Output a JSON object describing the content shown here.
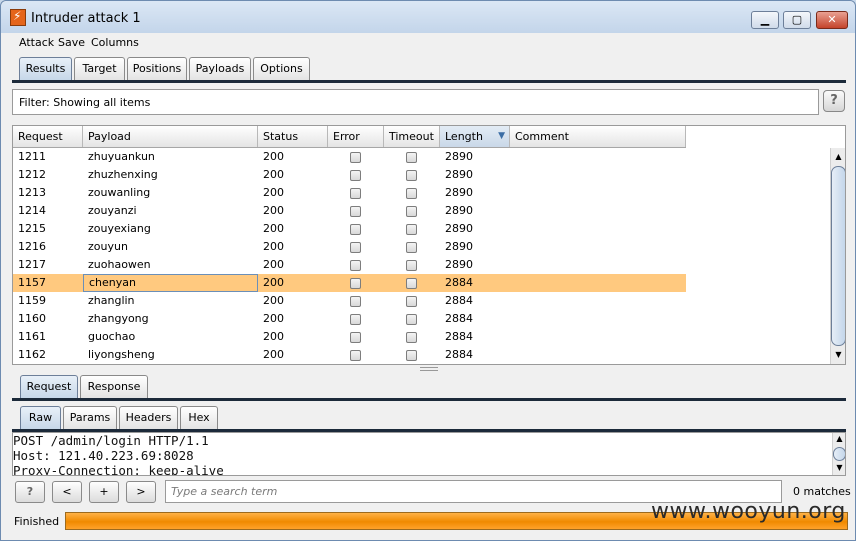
{
  "window": {
    "title": "Intruder attack 1"
  },
  "menu": [
    "Attack",
    "Save",
    "Columns"
  ],
  "main_tabs": [
    "Results",
    "Target",
    "Positions",
    "Payloads",
    "Options"
  ],
  "filter": {
    "text": "Filter:  Showing all items",
    "help": "?"
  },
  "table": {
    "columns": [
      "Request",
      "Payload",
      "Status",
      "Error",
      "Timeout",
      "Length",
      "Comment"
    ],
    "sorted_column": "Length",
    "rows": [
      {
        "request": "1211",
        "payload": "zhuyuankun",
        "status": "200",
        "error": false,
        "timeout": false,
        "length": "2890",
        "comment": ""
      },
      {
        "request": "1212",
        "payload": "zhuzhenxing",
        "status": "200",
        "error": false,
        "timeout": false,
        "length": "2890",
        "comment": ""
      },
      {
        "request": "1213",
        "payload": "zouwanling",
        "status": "200",
        "error": false,
        "timeout": false,
        "length": "2890",
        "comment": ""
      },
      {
        "request": "1214",
        "payload": "zouyanzi",
        "status": "200",
        "error": false,
        "timeout": false,
        "length": "2890",
        "comment": ""
      },
      {
        "request": "1215",
        "payload": "zouyexiang",
        "status": "200",
        "error": false,
        "timeout": false,
        "length": "2890",
        "comment": ""
      },
      {
        "request": "1216",
        "payload": "zouyun",
        "status": "200",
        "error": false,
        "timeout": false,
        "length": "2890",
        "comment": ""
      },
      {
        "request": "1217",
        "payload": "zuohaowen",
        "status": "200",
        "error": false,
        "timeout": false,
        "length": "2890",
        "comment": ""
      },
      {
        "request": "1157",
        "payload": "chenyan",
        "status": "200",
        "error": false,
        "timeout": false,
        "length": "2884",
        "comment": "",
        "selected": true
      },
      {
        "request": "1159",
        "payload": "zhanglin",
        "status": "200",
        "error": false,
        "timeout": false,
        "length": "2884",
        "comment": ""
      },
      {
        "request": "1160",
        "payload": "zhangyong",
        "status": "200",
        "error": false,
        "timeout": false,
        "length": "2884",
        "comment": ""
      },
      {
        "request": "1161",
        "payload": "guochao",
        "status": "200",
        "error": false,
        "timeout": false,
        "length": "2884",
        "comment": ""
      },
      {
        "request": "1162",
        "payload": "liyongsheng",
        "status": "200",
        "error": false,
        "timeout": false,
        "length": "2884",
        "comment": ""
      }
    ]
  },
  "detail_tabs": [
    "Request",
    "Response"
  ],
  "view_tabs": [
    "Raw",
    "Params",
    "Headers",
    "Hex"
  ],
  "request_text": [
    "POST /admin/login HTTP/1.1",
    "Host: 121.40.223.69:8028",
    "Proxy-Connection: keep-alive"
  ],
  "search_bar": {
    "help": "?",
    "prev": "<",
    "add": "+",
    "next": ">",
    "placeholder": "Type a search term",
    "matches": "0 matches"
  },
  "status": {
    "text": "Finished",
    "progress": 1.0
  },
  "watermark": "www.wooyun.org",
  "colors": {
    "selected_row": "#ffc97f",
    "progress": "#f08a00",
    "tab_active": "#c5d6e8"
  }
}
